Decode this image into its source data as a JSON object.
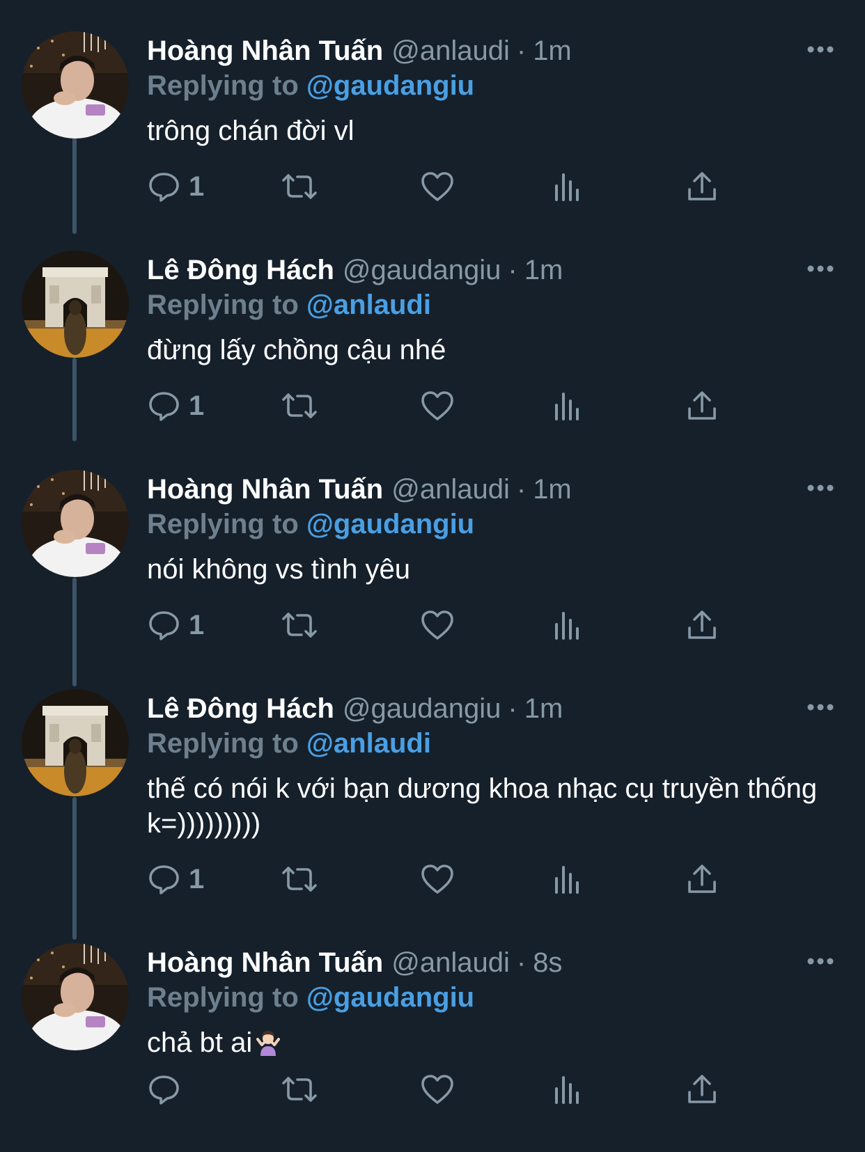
{
  "tweets": [
    {
      "name": "Hoàng Nhân Tuấn",
      "handle": "@anlaudi",
      "dot": "·",
      "time": "1m",
      "replying_label": "Replying to",
      "replying_to": "@gaudangiu",
      "text": "trông chán đời vl",
      "reply_count": "1",
      "avatar": "portrait-white-shirt"
    },
    {
      "name": "Lê Đông Hách",
      "handle": "@gaudangiu",
      "dot": "·",
      "time": "1m",
      "replying_label": "Replying to",
      "replying_to": "@anlaudi",
      "text": "đừng lấy chồng cậu nhé",
      "reply_count": "1",
      "avatar": "arc-de-triomphe-night"
    },
    {
      "name": "Hoàng Nhân Tuấn",
      "handle": "@anlaudi",
      "dot": "·",
      "time": "1m",
      "replying_label": "Replying to",
      "replying_to": "@gaudangiu",
      "text": "nói không vs tình yêu",
      "reply_count": "1",
      "avatar": "portrait-white-shirt"
    },
    {
      "name": "Lê Đông Hách",
      "handle": "@gaudangiu",
      "dot": "·",
      "time": "1m",
      "replying_label": "Replying to",
      "replying_to": "@anlaudi",
      "text": "thế có nói k với bạn dương khoa nhạc cụ truyền thống k=)))))))))",
      "reply_count": "1",
      "avatar": "arc-de-triomphe-night"
    },
    {
      "name": "Hoàng Nhân Tuấn",
      "handle": "@anlaudi",
      "dot": "·",
      "time": "8s",
      "replying_label": "Replying to",
      "replying_to": "@gaudangiu",
      "text": "chả bt ai",
      "reply_count": "",
      "avatar": "portrait-white-shirt"
    }
  ],
  "icons": {
    "more": "more-horizontal-icon",
    "reply": "reply-bubble-icon",
    "retweet": "retweet-icon",
    "like": "heart-icon",
    "views": "analytics-icon",
    "share": "share-icon",
    "emoji": "person-shrugging-emoji"
  },
  "colors": {
    "background": "#15202b",
    "mention": "#4a9fe3",
    "secondary_text": "#8899a6",
    "thread_line": "#3d5466"
  }
}
